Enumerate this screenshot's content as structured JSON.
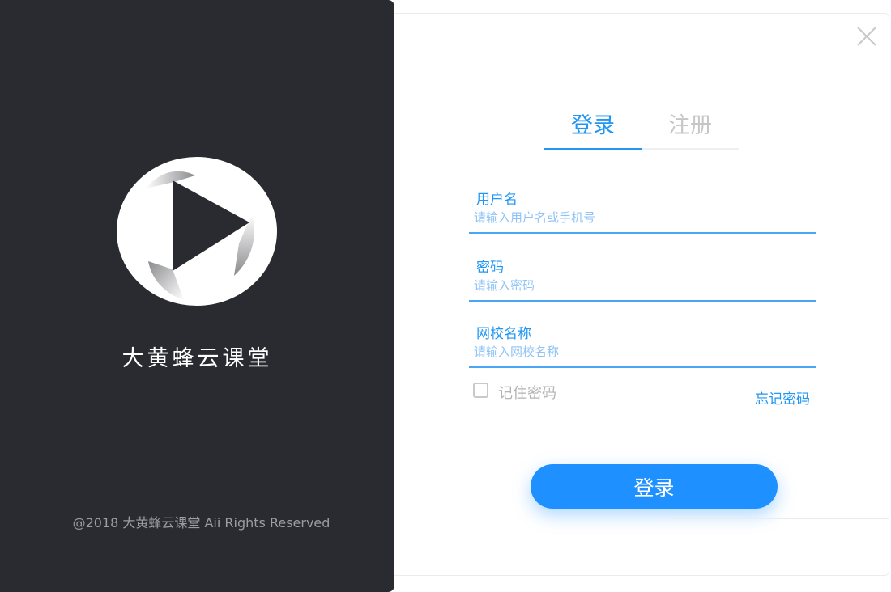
{
  "brand": {
    "logo_icon": "play-circle-icon",
    "name": "大黄蜂云课堂",
    "copyright": "@2018 大黄蜂云课堂 Aii Rights Reserved",
    "panel_color": "#2a2b30"
  },
  "window": {
    "close_icon": "close-icon"
  },
  "tabs": [
    {
      "label": "登录",
      "active": true
    },
    {
      "label": "注册",
      "active": false
    }
  ],
  "form": {
    "username": {
      "label": "用户名",
      "placeholder": "请输入用户名或手机号",
      "value": ""
    },
    "password": {
      "label": "密码",
      "placeholder": "请输入密码",
      "value": ""
    },
    "school": {
      "label": "网校名称",
      "placeholder": "请输入网校名称",
      "value": ""
    },
    "remember_label": "记住密码",
    "remember_checked": false,
    "forgot_label": "忘记密码",
    "submit_label": "登录"
  },
  "colors": {
    "accent": "#2196f3",
    "button": "#1e90ff",
    "inactive_tab": "#c6c6c6"
  }
}
